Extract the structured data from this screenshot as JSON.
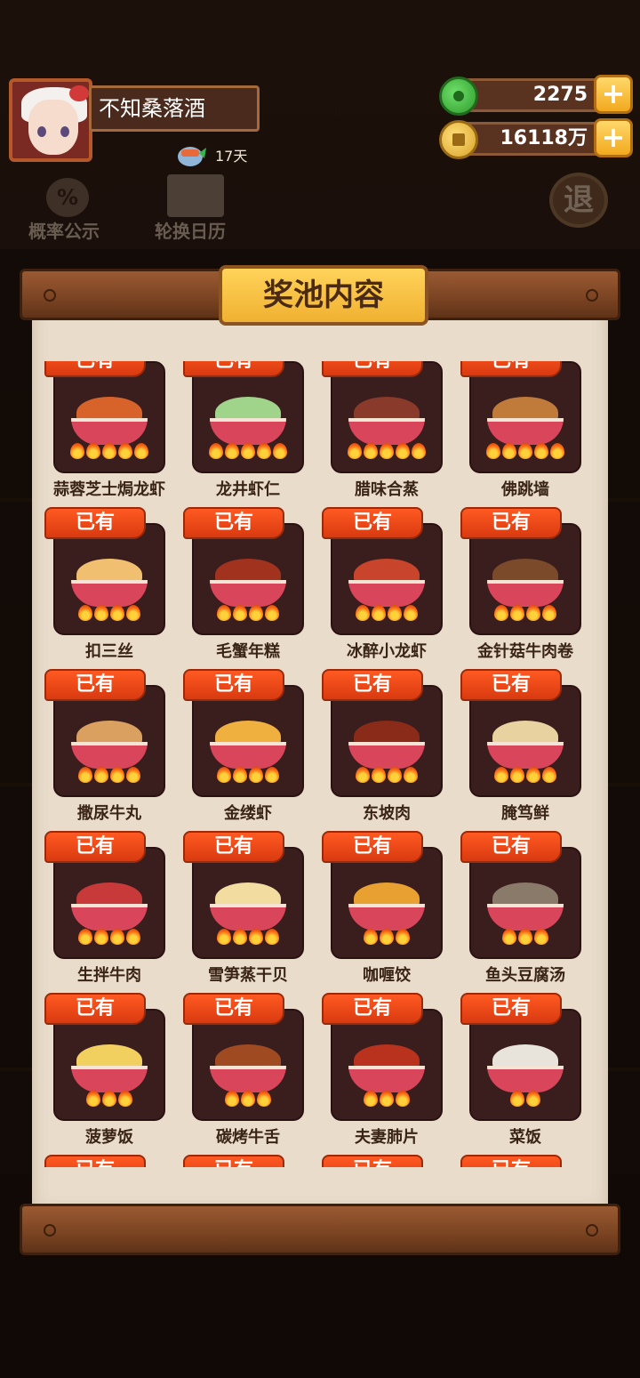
{
  "player": {
    "name": "不知桑落酒",
    "streak": "17天"
  },
  "currency": {
    "jade": "2275",
    "coins": "16118万"
  },
  "background": {
    "probability_label": "概率公示",
    "calendar_label": "轮换日历",
    "exit_label": "退"
  },
  "modal": {
    "title": "奖池内容",
    "owned_label": "已有",
    "dishes": [
      {
        "name": "蒜蓉芝士焗龙虾",
        "stars": 5,
        "food_color": "#d8632a"
      },
      {
        "name": "龙井虾仁",
        "stars": 5,
        "food_color": "#9fd48a"
      },
      {
        "name": "腊味合蒸",
        "stars": 5,
        "food_color": "#8a3a2a"
      },
      {
        "name": "佛跳墙",
        "stars": 5,
        "food_color": "#c07a3a"
      },
      {
        "name": "扣三丝",
        "stars": 4,
        "food_color": "#f0c070"
      },
      {
        "name": "毛蟹年糕",
        "stars": 4,
        "food_color": "#a0321e"
      },
      {
        "name": "冰醉小龙虾",
        "stars": 4,
        "food_color": "#c8442a"
      },
      {
        "name": "金针菇牛肉卷",
        "stars": 4,
        "food_color": "#7a4a2a"
      },
      {
        "name": "撒尿牛丸",
        "stars": 4,
        "food_color": "#d9a060"
      },
      {
        "name": "金缕虾",
        "stars": 4,
        "food_color": "#f0b040"
      },
      {
        "name": "东坡肉",
        "stars": 4,
        "food_color": "#8a2a18"
      },
      {
        "name": "腌笃鲜",
        "stars": 4,
        "food_color": "#e8d2a0"
      },
      {
        "name": "生拌牛肉",
        "stars": 4,
        "food_color": "#c83a3a"
      },
      {
        "name": "雪笋蒸干贝",
        "stars": 4,
        "food_color": "#f2dca0"
      },
      {
        "name": "咖喱饺",
        "stars": 3,
        "food_color": "#e8a030"
      },
      {
        "name": "鱼头豆腐汤",
        "stars": 3,
        "food_color": "#8a7a6a"
      },
      {
        "name": "菠萝饭",
        "stars": 3,
        "food_color": "#f2d060"
      },
      {
        "name": "碳烤牛舌",
        "stars": 3,
        "food_color": "#a04a22"
      },
      {
        "name": "夫妻肺片",
        "stars": 3,
        "food_color": "#b8321e"
      },
      {
        "name": "菜饭",
        "stars": 2,
        "food_color": "#e8e4dc"
      },
      {
        "name": "",
        "stars": 0,
        "food_color": ""
      },
      {
        "name": "",
        "stars": 0,
        "food_color": ""
      },
      {
        "name": "",
        "stars": 0,
        "food_color": ""
      },
      {
        "name": "",
        "stars": 0,
        "food_color": ""
      }
    ]
  },
  "colors": {
    "owned_tag": "#e8481a",
    "card_bg": "#3a1d1d",
    "paper": "#e9dccb"
  }
}
